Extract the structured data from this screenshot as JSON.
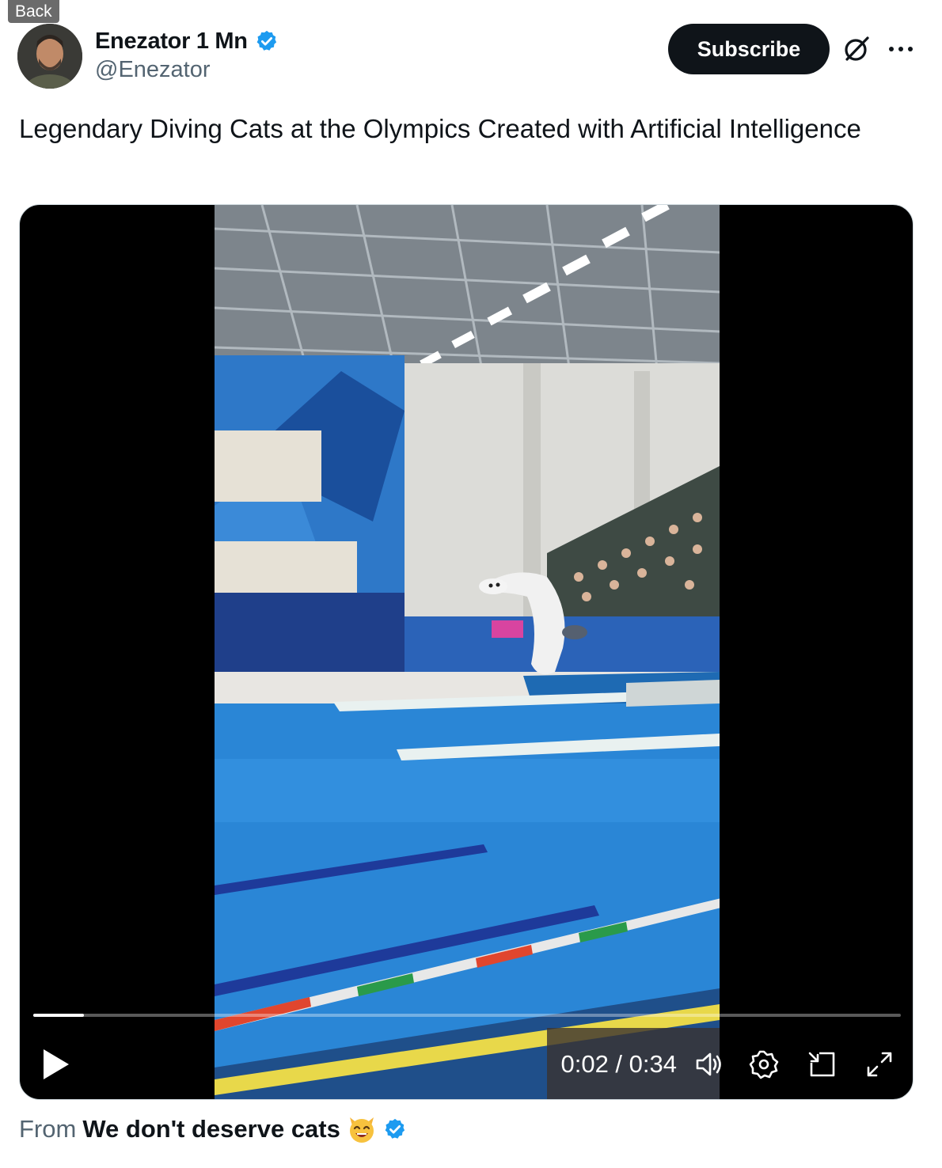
{
  "back_label": "Back",
  "author": {
    "name": "Enezator 1 Mn",
    "handle": "@Enezator",
    "verified": true
  },
  "actions": {
    "subscribe_label": "Subscribe",
    "grok_icon": "grok-icon",
    "more_icon": "more-icon"
  },
  "tweet": {
    "text": "Legendary Diving Cats at the Olympics Created with Artificial Intelligence"
  },
  "video": {
    "current_time": "0:02",
    "duration": "0:34",
    "time_display": "0:02 / 0:34",
    "progress_fraction": 0.058,
    "controls": [
      "play-icon",
      "volume-icon",
      "settings-icon",
      "picture-in-picture-icon",
      "fullscreen-icon"
    ]
  },
  "source": {
    "from_label": "From",
    "name": "We don't deserve cats",
    "emoji": "smiling-cat-emoji",
    "verified": true
  },
  "colors": {
    "text_primary": "#0f1419",
    "text_secondary": "#536471",
    "verified_blue": "#1d9bf0",
    "button_dark": "#0f1419"
  }
}
